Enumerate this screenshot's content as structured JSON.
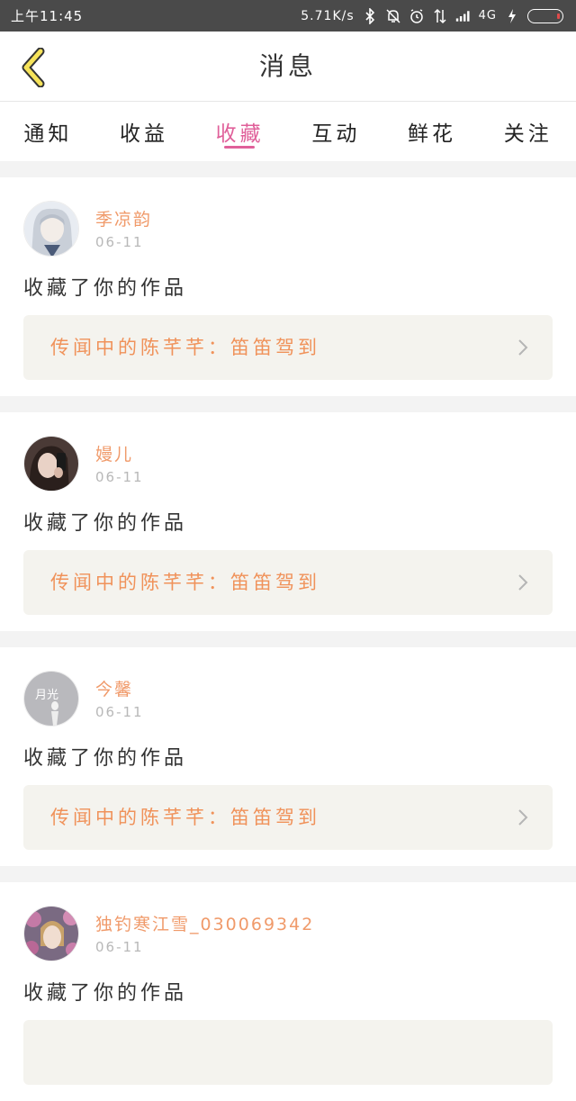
{
  "status_bar": {
    "time": "上午11:45",
    "network_speed": "5.71K/s",
    "network_type": "4G",
    "icons": [
      "bluetooth-icon",
      "mute-bell-icon",
      "alarm-icon",
      "data-arrows-icon",
      "signal-icon",
      "charging-icon",
      "battery-icon"
    ]
  },
  "header": {
    "title": "消息",
    "back_icon": "chevron-left-icon"
  },
  "tabs": [
    {
      "label": "通知",
      "active": false
    },
    {
      "label": "收益",
      "active": false
    },
    {
      "label": "收藏",
      "active": true
    },
    {
      "label": "互动",
      "active": false
    },
    {
      "label": "鲜花",
      "active": false
    },
    {
      "label": "关注",
      "active": false
    }
  ],
  "colors": {
    "accent_pink": "#e0609a",
    "username_orange": "#f09a6a",
    "work_title_orange": "#f0925a",
    "statusbar_bg": "#4a4a4a",
    "work_box_bg": "#f4f3ee"
  },
  "messages": [
    {
      "user": "季凉韵",
      "date": "06-11",
      "action": "收藏了你的作品",
      "work_title": "传闻中的陈芊芊：笛笛驾到",
      "avatar": "anime-girl"
    },
    {
      "user": "嫚儿",
      "date": "06-11",
      "action": "收藏了你的作品",
      "work_title": "传闻中的陈芊芊：笛笛驾到",
      "avatar": "selfie"
    },
    {
      "user": "今馨",
      "date": "06-11",
      "action": "收藏了你的作品",
      "work_title": "传闻中的陈芊芊：笛笛驾到",
      "avatar": "grey-figure",
      "avatar_text": "月光"
    },
    {
      "user": "独钓寒江雪_030069342",
      "date": "06-11",
      "action": "收藏了你的作品",
      "work_title": "",
      "avatar": "flowers-portrait"
    }
  ]
}
